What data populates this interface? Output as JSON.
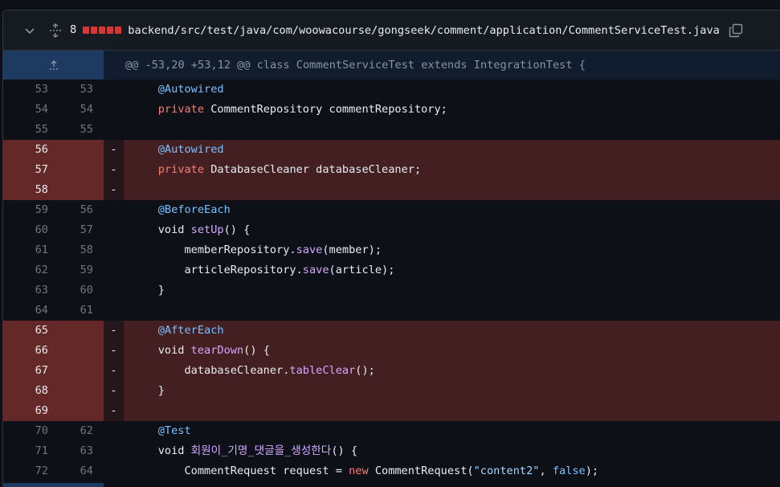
{
  "file": {
    "changed_count": "8",
    "path": "backend/src/test/java/com/woowacourse/gongseek/comment/application/CommentServiceTest.java",
    "diffstat_color": "#da3633",
    "diffstat_blocks": 5
  },
  "hunk": {
    "header": "@@ -53,20 +53,12 @@ class CommentServiceTest extends IntegrationTest {"
  },
  "lines": [
    {
      "old": "53",
      "new": "53",
      "marker": "",
      "type": "ctx",
      "tokens": [
        {
          "t": "    "
        },
        {
          "t": "@Autowired",
          "c": "ann"
        }
      ]
    },
    {
      "old": "54",
      "new": "54",
      "marker": "",
      "type": "ctx",
      "tokens": [
        {
          "t": "    "
        },
        {
          "t": "private",
          "c": "kw"
        },
        {
          "t": " CommentRepository commentRepository;"
        }
      ]
    },
    {
      "old": "55",
      "new": "55",
      "marker": "",
      "type": "ctx",
      "tokens": [
        {
          "t": ""
        }
      ]
    },
    {
      "old": "56",
      "new": "",
      "marker": "-",
      "type": "del",
      "tokens": [
        {
          "t": "    "
        },
        {
          "t": "@Autowired",
          "c": "ann"
        }
      ]
    },
    {
      "old": "57",
      "new": "",
      "marker": "-",
      "type": "del",
      "tokens": [
        {
          "t": "    "
        },
        {
          "t": "private",
          "c": "kw"
        },
        {
          "t": " DatabaseCleaner databaseCleaner;"
        }
      ]
    },
    {
      "old": "58",
      "new": "",
      "marker": "-",
      "type": "del",
      "tokens": [
        {
          "t": ""
        }
      ]
    },
    {
      "old": "59",
      "new": "56",
      "marker": "",
      "type": "ctx",
      "tokens": [
        {
          "t": "    "
        },
        {
          "t": "@BeforeEach",
          "c": "ann"
        }
      ]
    },
    {
      "old": "60",
      "new": "57",
      "marker": "",
      "type": "ctx",
      "tokens": [
        {
          "t": "    void "
        },
        {
          "t": "setUp",
          "c": "fn"
        },
        {
          "t": "() {"
        }
      ]
    },
    {
      "old": "61",
      "new": "58",
      "marker": "",
      "type": "ctx",
      "tokens": [
        {
          "t": "        memberRepository."
        },
        {
          "t": "save",
          "c": "fn"
        },
        {
          "t": "(member);"
        }
      ]
    },
    {
      "old": "62",
      "new": "59",
      "marker": "",
      "type": "ctx",
      "tokens": [
        {
          "t": "        articleRepository."
        },
        {
          "t": "save",
          "c": "fn"
        },
        {
          "t": "(article);"
        }
      ]
    },
    {
      "old": "63",
      "new": "60",
      "marker": "",
      "type": "ctx",
      "tokens": [
        {
          "t": "    }"
        }
      ]
    },
    {
      "old": "64",
      "new": "61",
      "marker": "",
      "type": "ctx",
      "tokens": [
        {
          "t": ""
        }
      ]
    },
    {
      "old": "65",
      "new": "",
      "marker": "-",
      "type": "del",
      "tokens": [
        {
          "t": "    "
        },
        {
          "t": "@AfterEach",
          "c": "ann"
        }
      ]
    },
    {
      "old": "66",
      "new": "",
      "marker": "-",
      "type": "del",
      "tokens": [
        {
          "t": "    void "
        },
        {
          "t": "tearDown",
          "c": "fn"
        },
        {
          "t": "() {"
        }
      ]
    },
    {
      "old": "67",
      "new": "",
      "marker": "-",
      "type": "del",
      "tokens": [
        {
          "t": "        databaseCleaner."
        },
        {
          "t": "tableClear",
          "c": "fn"
        },
        {
          "t": "();"
        }
      ]
    },
    {
      "old": "68",
      "new": "",
      "marker": "-",
      "type": "del",
      "tokens": [
        {
          "t": "    }"
        }
      ]
    },
    {
      "old": "69",
      "new": "",
      "marker": "-",
      "type": "del",
      "tokens": [
        {
          "t": ""
        }
      ]
    },
    {
      "old": "70",
      "new": "62",
      "marker": "",
      "type": "ctx",
      "tokens": [
        {
          "t": "    "
        },
        {
          "t": "@Test",
          "c": "ann"
        }
      ]
    },
    {
      "old": "71",
      "new": "63",
      "marker": "",
      "type": "ctx",
      "tokens": [
        {
          "t": "    void "
        },
        {
          "t": "회원이_기명_댓글을_생성한다",
          "c": "fn"
        },
        {
          "t": "() {"
        }
      ]
    },
    {
      "old": "72",
      "new": "64",
      "marker": "",
      "type": "ctx",
      "tokens": [
        {
          "t": "        CommentRequest request = "
        },
        {
          "t": "new",
          "c": "kw"
        },
        {
          "t": " CommentRequest("
        },
        {
          "t": "\"content2\"",
          "c": "str"
        },
        {
          "t": ", "
        },
        {
          "t": "false",
          "c": "lit"
        },
        {
          "t": ");"
        }
      ]
    }
  ]
}
